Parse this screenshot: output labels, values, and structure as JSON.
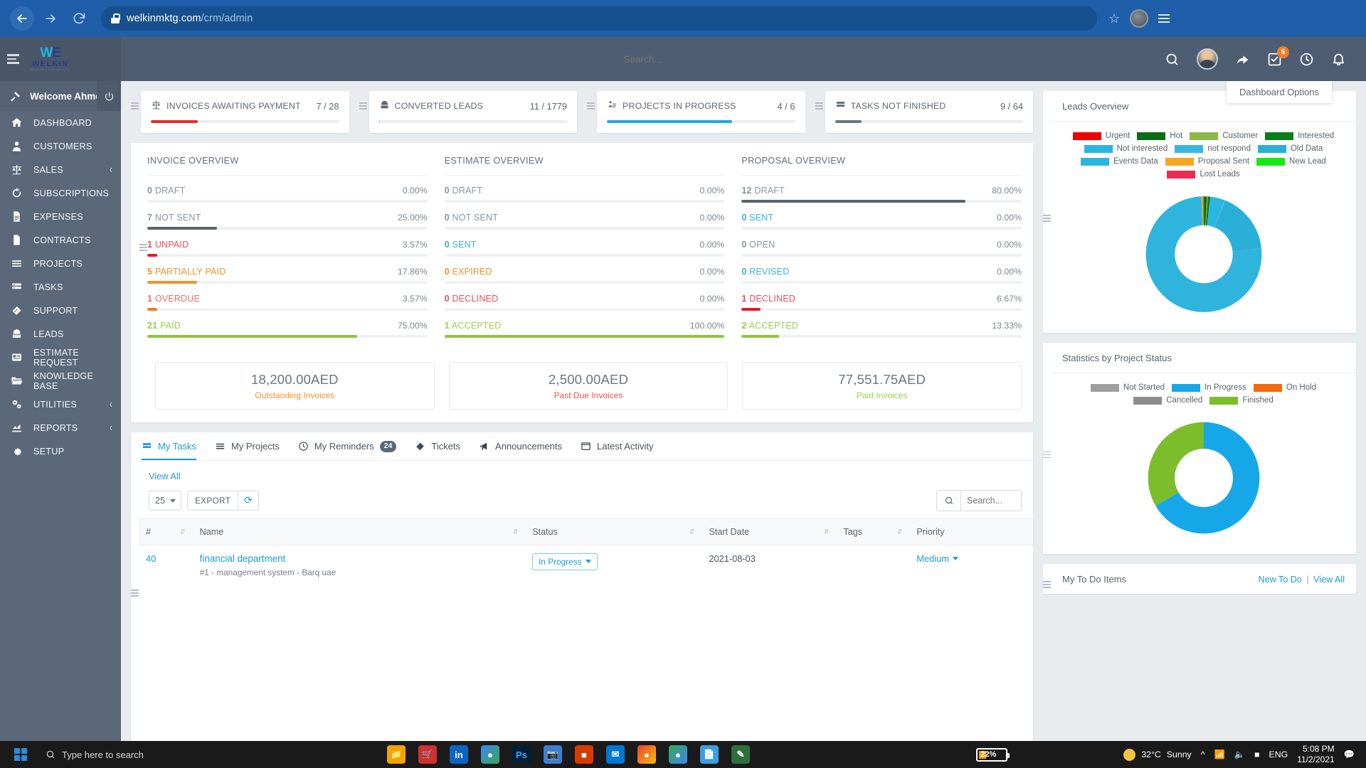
{
  "browser": {
    "url_domain": "welkinmktg.com",
    "url_path": "/crm/admin",
    "back_icon": "back-arrow-icon",
    "forward_icon": "forward-arrow-icon",
    "reload_icon": "reload-icon"
  },
  "topbar": {
    "logo_mark": "W",
    "logo_mark_accent": "E",
    "logo_name": "WELKIN",
    "logo_tagline": "Marketing Management",
    "search_placeholder": "Search...",
    "notifications_badge": "5",
    "dashboard_options": "Dashboard Options"
  },
  "sidebar": {
    "welcome": "Welcome Ahmed",
    "items": [
      {
        "label": "DASHBOARD",
        "icon": "home-icon",
        "caret": false
      },
      {
        "label": "CUSTOMERS",
        "icon": "user-icon",
        "caret": false
      },
      {
        "label": "SALES",
        "icon": "scales-icon",
        "caret": true
      },
      {
        "label": "SUBSCRIPTIONS",
        "icon": "refresh-icon",
        "caret": false
      },
      {
        "label": "EXPENSES",
        "icon": "file-lines-icon",
        "caret": false
      },
      {
        "label": "CONTRACTS",
        "icon": "document-icon",
        "caret": false
      },
      {
        "label": "PROJECTS",
        "icon": "list-icon",
        "caret": false
      },
      {
        "label": "TASKS",
        "icon": "tasks-icon",
        "caret": false
      },
      {
        "label": "SUPPORT",
        "icon": "ticket-icon",
        "caret": false
      },
      {
        "label": "LEADS",
        "icon": "leads-icon",
        "caret": false
      },
      {
        "label": "ESTIMATE REQUEST",
        "icon": "form-icon",
        "caret": false
      },
      {
        "label": "KNOWLEDGE BASE",
        "icon": "folder-icon",
        "caret": false
      },
      {
        "label": "UTILITIES",
        "icon": "gears-icon",
        "caret": true
      },
      {
        "label": "REPORTS",
        "icon": "chart-icon",
        "caret": true
      },
      {
        "label": "SETUP",
        "icon": "gear-icon",
        "caret": false
      }
    ]
  },
  "kpis": [
    {
      "title": "INVOICES AWAITING PAYMENT",
      "value": "7 / 28",
      "icon": "scales-icon",
      "percent": 25,
      "color": "#e02d2d"
    },
    {
      "title": "CONVERTED LEADS",
      "value": "11 / 1779",
      "icon": "leads-icon",
      "percent": 0.6,
      "color": "#8bc34a"
    },
    {
      "title": "PROJECTS IN PROGRESS",
      "value": "4 / 6",
      "icon": "project-icon",
      "percent": 66.7,
      "color": "#20a8e0"
    },
    {
      "title": "TASKS NOT FINISHED",
      "value": "9 / 64",
      "icon": "tasks-icon",
      "percent": 14.1,
      "color": "#6c757d"
    }
  ],
  "overview": {
    "columns": [
      {
        "title": "INVOICE OVERVIEW",
        "rows": [
          {
            "count": "0",
            "label": "DRAFT",
            "pct": "0.00%",
            "bar": 0,
            "color": "#6c757d",
            "text": "#8b949d"
          },
          {
            "count": "7",
            "label": "NOT SENT",
            "pct": "25.00%",
            "bar": 25,
            "color": "#5a636c",
            "text": "#8b949d"
          },
          {
            "count": "1",
            "label": "UNPAID",
            "pct": "3.57%",
            "bar": 3.57,
            "color": "#e8162b",
            "text": "#ef4b5d"
          },
          {
            "count": "5",
            "label": "PARTIALLY PAID",
            "pct": "17.86%",
            "bar": 17.86,
            "color": "#f0932b",
            "text": "#f0932b"
          },
          {
            "count": "1",
            "label": "OVERDUE",
            "pct": "3.57%",
            "bar": 3.57,
            "color": "#f07f12",
            "text": "#ef6b6b"
          },
          {
            "count": "21",
            "label": "PAID",
            "pct": "75.00%",
            "bar": 75,
            "color": "#8cc63f",
            "text": "#9acd52"
          }
        ]
      },
      {
        "title": "ESTIMATE OVERVIEW",
        "rows": [
          {
            "count": "0",
            "label": "DRAFT",
            "pct": "0.00%",
            "bar": 0,
            "color": "#6c757d",
            "text": "#8b949d"
          },
          {
            "count": "0",
            "label": "NOT SENT",
            "pct": "0.00%",
            "bar": 0,
            "color": "#5a636c",
            "text": "#8b949d"
          },
          {
            "count": "0",
            "label": "SENT",
            "pct": "0.00%",
            "bar": 0,
            "color": "#20a8e0",
            "text": "#3eaede"
          },
          {
            "count": "0",
            "label": "EXPIRED",
            "pct": "0.00%",
            "bar": 0,
            "color": "#f0932b",
            "text": "#f0932b"
          },
          {
            "count": "0",
            "label": "DECLINED",
            "pct": "0.00%",
            "bar": 0,
            "color": "#e8162b",
            "text": "#ef4b5d"
          },
          {
            "count": "1",
            "label": "ACCEPTED",
            "pct": "100.00%",
            "bar": 100,
            "color": "#8cc63f",
            "text": "#9acd52"
          }
        ]
      },
      {
        "title": "PROPOSAL OVERVIEW",
        "rows": [
          {
            "count": "12",
            "label": "DRAFT",
            "pct": "80.00%",
            "bar": 80,
            "color": "#5a636c",
            "text": "#8b949d"
          },
          {
            "count": "0",
            "label": "SENT",
            "pct": "0.00%",
            "bar": 0,
            "color": "#20a8e0",
            "text": "#3eaede"
          },
          {
            "count": "0",
            "label": "OPEN",
            "pct": "0.00%",
            "bar": 0,
            "color": "#6c757d",
            "text": "#8b949d"
          },
          {
            "count": "0",
            "label": "REVISED",
            "pct": "0.00%",
            "bar": 0,
            "color": "#20a8e0",
            "text": "#3eaede"
          },
          {
            "count": "1",
            "label": "DECLINED",
            "pct": "6.67%",
            "bar": 6.67,
            "color": "#e8162b",
            "text": "#ef4b5d"
          },
          {
            "count": "2",
            "label": "ACCEPTED",
            "pct": "13.33%",
            "bar": 13.33,
            "color": "#8cc63f",
            "text": "#9acd52"
          }
        ]
      }
    ],
    "money": [
      {
        "amount": "18,200.00AED",
        "label": "Outstanding Invoices",
        "color": "#f0932b"
      },
      {
        "amount": "2,500.00AED",
        "label": "Past Due Invoices",
        "color": "#ef5350"
      },
      {
        "amount": "77,551.75AED",
        "label": "Paid Invoices",
        "color": "#9acd52"
      }
    ]
  },
  "tasks_panel": {
    "tabs": [
      {
        "label": "My Tasks",
        "icon": "tasks-icon",
        "badge": "",
        "active": true
      },
      {
        "label": "My Projects",
        "icon": "list-icon",
        "badge": "",
        "active": false
      },
      {
        "label": "My Reminders",
        "icon": "clock-icon",
        "badge": "24",
        "active": false
      },
      {
        "label": "Tickets",
        "icon": "ticket-icon",
        "badge": "",
        "active": false
      },
      {
        "label": "Announcements",
        "icon": "megaphone-icon",
        "badge": "",
        "active": false
      },
      {
        "label": "Latest Activity",
        "icon": "window-icon",
        "badge": "",
        "active": false
      }
    ],
    "view_all": "View All",
    "page_size": "25",
    "page_size_options": [
      "25"
    ],
    "export_label": "EXPORT",
    "refresh_icon": "refresh-icon",
    "search_placeholder": "Search...",
    "columns": [
      "#",
      "Name",
      "Status",
      "Start Date",
      "Tags",
      "Priority"
    ],
    "rows": [
      {
        "num": "40",
        "name": "financial department",
        "subtitle": "#1 - management system - Barq uae",
        "status": "In Progress",
        "start_date": "2021-08-03",
        "tags": "",
        "priority": "Medium"
      }
    ]
  },
  "leads_overview": {
    "title": "Leads Overview",
    "chart_data": {
      "type": "pie",
      "title": "Leads Overview",
      "legend_position": "top",
      "labels": [
        "Urgent",
        "Hot",
        "Customer",
        "Interested",
        "Not interested",
        "not respond",
        "Old Data",
        "Events Data",
        "Proposal Sent",
        "New Lead",
        "Lost Leads"
      ],
      "colors": [
        "#ee0000",
        "#0a6b16",
        "#8cb84a",
        "#0a7d19",
        "#29b6e0",
        "#35b8e0",
        "#29afd8",
        "#2fb4de",
        "#f5a623",
        "#18e818",
        "#ec2b52"
      ],
      "values": [
        1,
        12,
        4,
        10,
        62,
        2,
        260,
        1140,
        5,
        3,
        2
      ]
    }
  },
  "project_status": {
    "title": "Statistics by Project Status",
    "chart_data": {
      "type": "pie",
      "title": "Statistics by Project Status",
      "legend_position": "top",
      "labels": [
        "Not Started",
        "In Progress",
        "On Hold",
        "Cancelled",
        "Finished"
      ],
      "colors": [
        "#9e9e9e",
        "#16a7e8",
        "#f4690b",
        "#8d8d8d",
        "#7cbd2c"
      ],
      "values": [
        0,
        4,
        0,
        0,
        2
      ]
    }
  },
  "todo_panel": {
    "title": "My To Do Items",
    "new_todo": "New To Do",
    "view_all": "View All",
    "separator": "|"
  },
  "taskbar": {
    "search_placeholder": "Type here to search",
    "battery": "22%",
    "battery_level": 22,
    "weather_temp": "32°C",
    "weather_desc": "Sunny",
    "language": "ENG",
    "time": "5:08 PM",
    "date": "11/2/2021"
  }
}
